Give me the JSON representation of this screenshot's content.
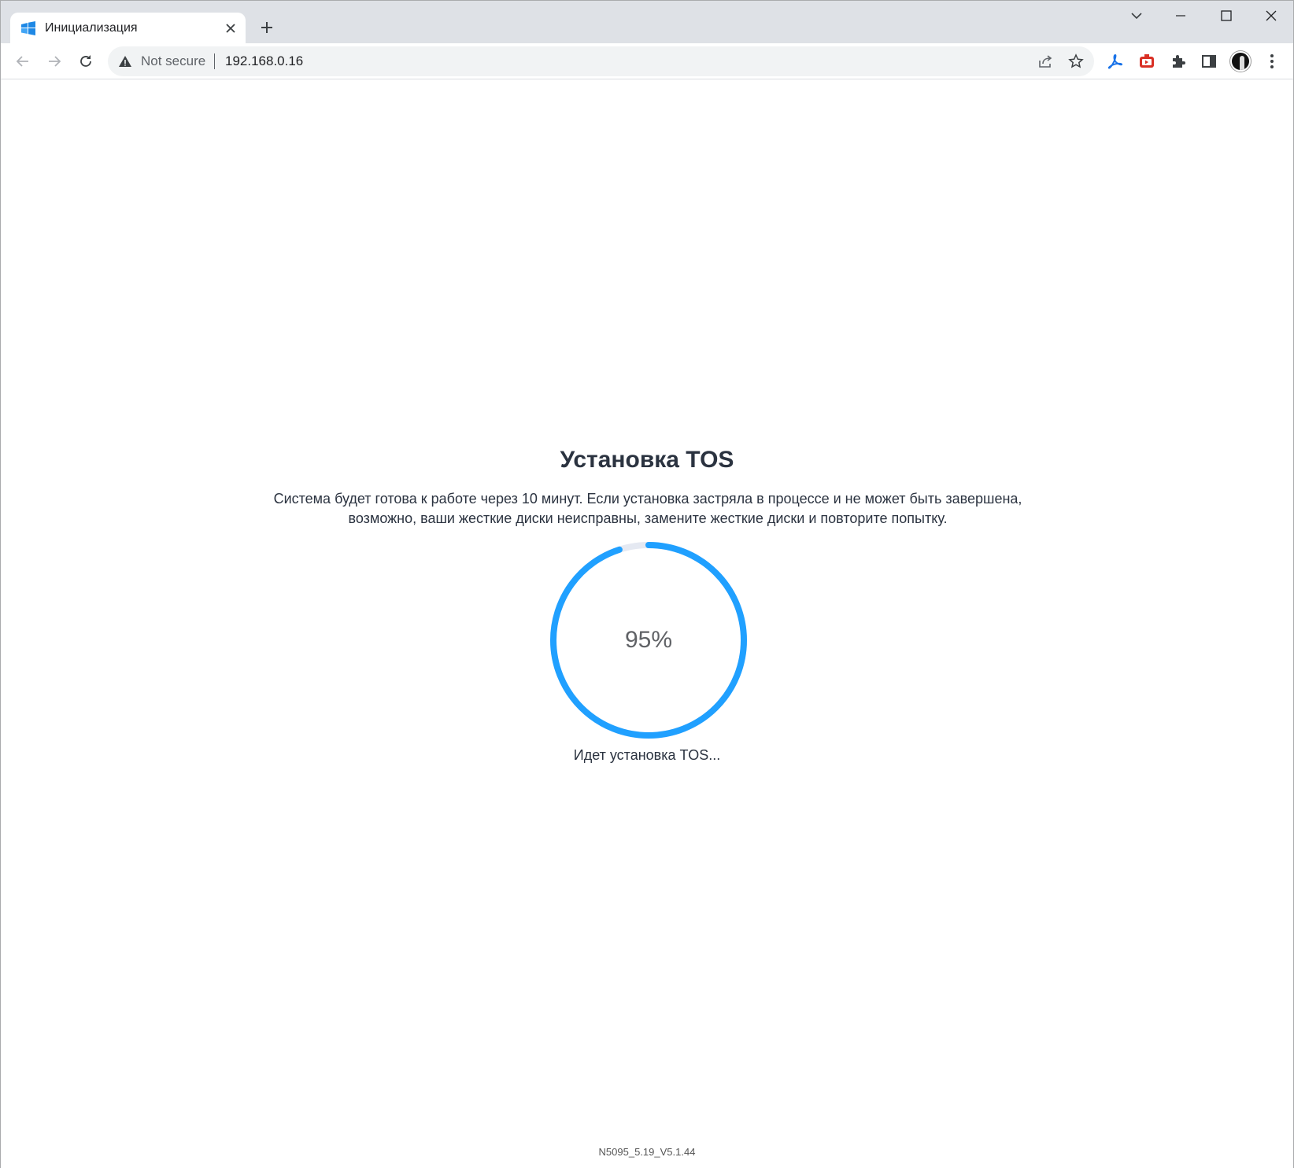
{
  "tab": {
    "title": "Инициализация",
    "favicon": "nas-window-icon"
  },
  "toolbar": {
    "security_label": "Not secure",
    "url": "192.168.0.16"
  },
  "main": {
    "heading": "Установка TOS",
    "description": "Система будет готова к работе через 10 минут. Если установка застряла в процессе и не может быть завершена, возможно, ваши жесткие диски неисправны, замените жесткие диски и повторите попытку.",
    "progress_value": 0.95,
    "progress_text": "95%",
    "status_text": "Идет установка TOS...",
    "version": "N5095_5.19_V5.1.44"
  },
  "colors": {
    "progress_fill": "#20a0ff",
    "progress_track": "#e5e9f2",
    "tabstrip": "#dee1e6"
  }
}
